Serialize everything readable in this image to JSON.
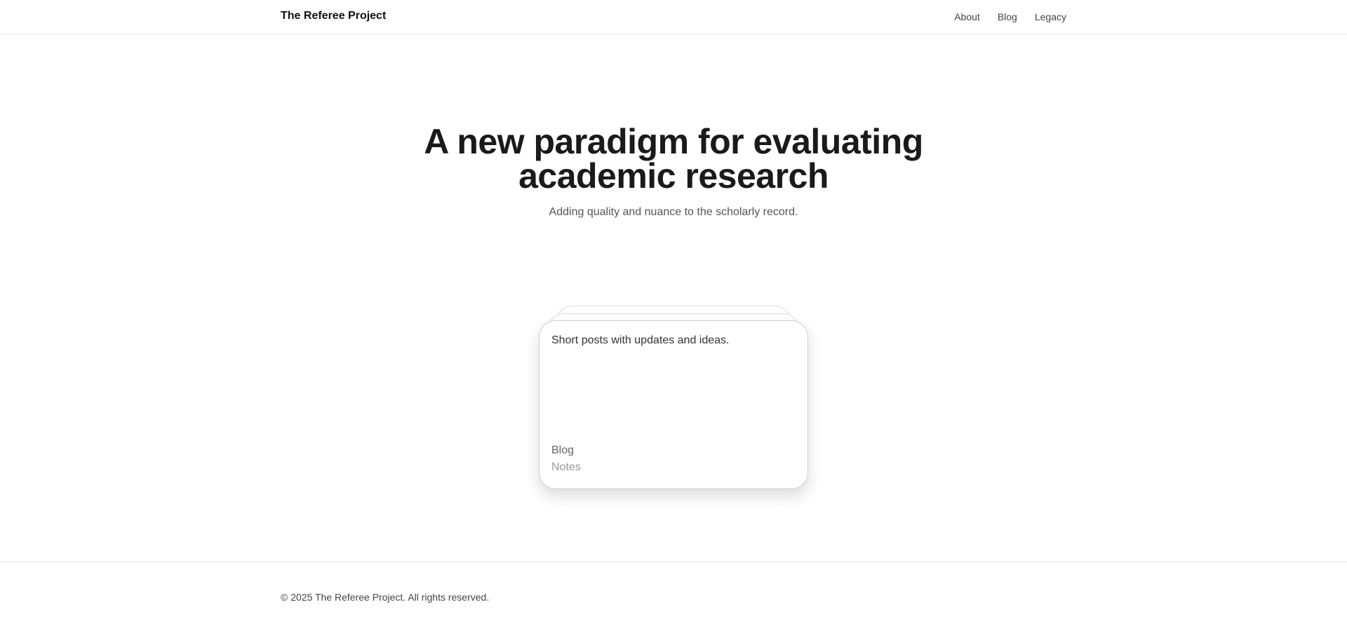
{
  "header": {
    "brand": "The Referee Project",
    "nav": [
      {
        "label": "About"
      },
      {
        "label": "Blog"
      },
      {
        "label": "Legacy"
      }
    ]
  },
  "hero": {
    "title": "A new paradigm for evaluating academic research",
    "subtitle": "Adding quality and nuance to the scholarly record."
  },
  "card": {
    "description": "Short posts with updates and ideas.",
    "title": "Blog",
    "subtitle": "Notes"
  },
  "footer": {
    "copyright": "© 2025 The Referee Project. All rights reserved."
  }
}
